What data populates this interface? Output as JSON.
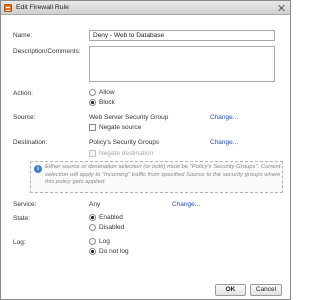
{
  "dialog": {
    "title": "Edit Firewall Rule"
  },
  "form": {
    "name": {
      "label": "Name:",
      "value": "Deny - Web to Database"
    },
    "description": {
      "label": "Description/Comments:",
      "value": ""
    },
    "action": {
      "label": "Action:",
      "options": [
        "Allow",
        "Block"
      ],
      "selected": "Block"
    },
    "source": {
      "label": "Source:",
      "value": "Web Server Security Group",
      "change_link": "Change...",
      "negate_label": "Negate source"
    },
    "destination": {
      "label": "Destination:",
      "value": "Policy's Security Groups",
      "change_link": "Change...",
      "negate_label": "Negate destination"
    },
    "info": {
      "text": "Either source or destination selection (or both) must be \"Policy's Security Groups\". Current selection will apply to \"Incoming\" traffic from specified Source to the security groups where this policy gets applied."
    },
    "service": {
      "label": "Service:",
      "value": "Any",
      "change_link": "Change..."
    },
    "state": {
      "label": "State:",
      "options": [
        "Enabled",
        "Disabled"
      ],
      "selected": "Enabled"
    },
    "log": {
      "label": "Log:",
      "options": [
        "Log",
        "Do not log"
      ],
      "selected": "Do not log"
    }
  },
  "buttons": {
    "ok": "OK",
    "cancel": "Cancel"
  }
}
